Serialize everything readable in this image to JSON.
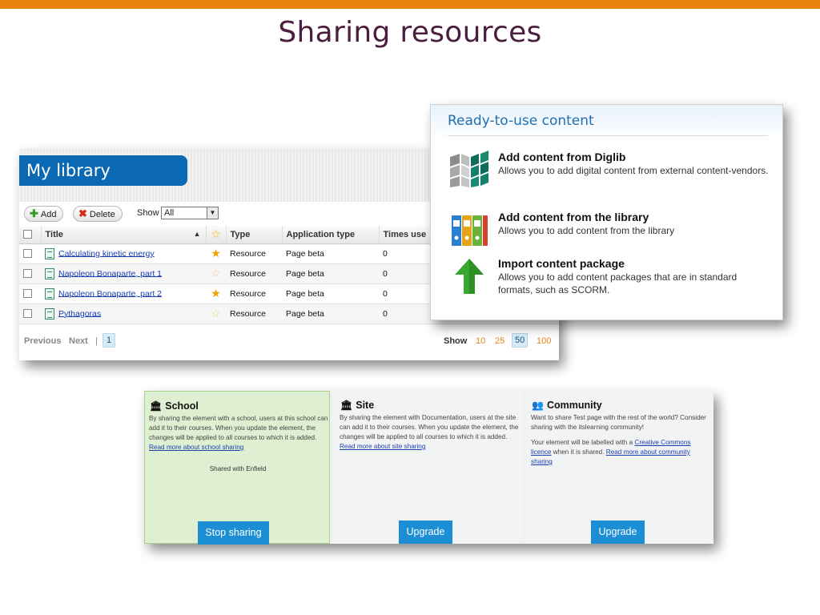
{
  "slide": {
    "title": "Sharing resources"
  },
  "library": {
    "title": "My library",
    "toolbar": {
      "add_label": "Add",
      "delete_label": "Delete",
      "show_label": "Show",
      "show_value": "All"
    },
    "columns": {
      "title": "Title",
      "type": "Type",
      "app_type": "Application type",
      "times_used": "Times use"
    },
    "rows": [
      {
        "title": "Calculating kinetic energy",
        "type": "Resource",
        "app_type": "Page beta",
        "times": "0",
        "starred": true
      },
      {
        "title": "Napoleon Bonaparte, part 1",
        "type": "Resource",
        "app_type": "Page beta",
        "times": "0",
        "starred": false
      },
      {
        "title": "Napoleon Bonaparte, part 2",
        "type": "Resource",
        "app_type": "Page beta",
        "times": "0",
        "starred": true
      },
      {
        "title": "Pythagoras",
        "type": "Resource",
        "app_type": "Page beta",
        "times": "0",
        "starred": false
      }
    ],
    "pagination": {
      "previous": "Previous",
      "next": "Next",
      "separator": "|",
      "page": "1"
    },
    "show_counts": {
      "label": "Show",
      "options": [
        "10",
        "25",
        "50",
        "100"
      ],
      "selected": "50"
    }
  },
  "ready": {
    "title": "Ready-to-use content",
    "items": [
      {
        "head": "Add content from Diglib",
        "desc": "Allows you to add digital content from external content-vendors.",
        "icon": "cubes-icon"
      },
      {
        "head": "Add content from the library",
        "desc": "Allows you to add content from the library",
        "icon": "binders-icon"
      },
      {
        "head": "Import content package",
        "desc": "Allows you to add content packages that are in standard formats, such as SCORM.",
        "icon": "upload-arrow-icon"
      }
    ]
  },
  "sharing": {
    "school": {
      "head": "School",
      "body": "By sharing the element with a school, users at this school can add it to their courses. When you update the element, the changes will be applied to all courses to which it is added.",
      "link": "Read more about school sharing",
      "shared_with": "Shared with Enfield",
      "button": "Stop sharing"
    },
    "site": {
      "head": "Site",
      "body": "By sharing the element with Documentation, users at the site can add it to their courses. When you update the element, the changes will be applied to all courses to which it is added.",
      "link": "Read more about site sharing",
      "button": "Upgrade"
    },
    "community": {
      "head": "Community",
      "body1": "Want to share Test page with the rest of the world? Consider sharing with the itslearning community!",
      "body2_pre": "Your element will be labelled with a",
      "body2_link": "Creative Commons licence",
      "body2_post": "when it is shared.",
      "link": "Read more about community sharing",
      "button": "Upgrade"
    }
  },
  "colors": {
    "accent_orange": "#e8830f",
    "title_plum": "#4a1e3f",
    "library_blue": "#0b69b3",
    "button_blue": "#1b8ed4"
  }
}
